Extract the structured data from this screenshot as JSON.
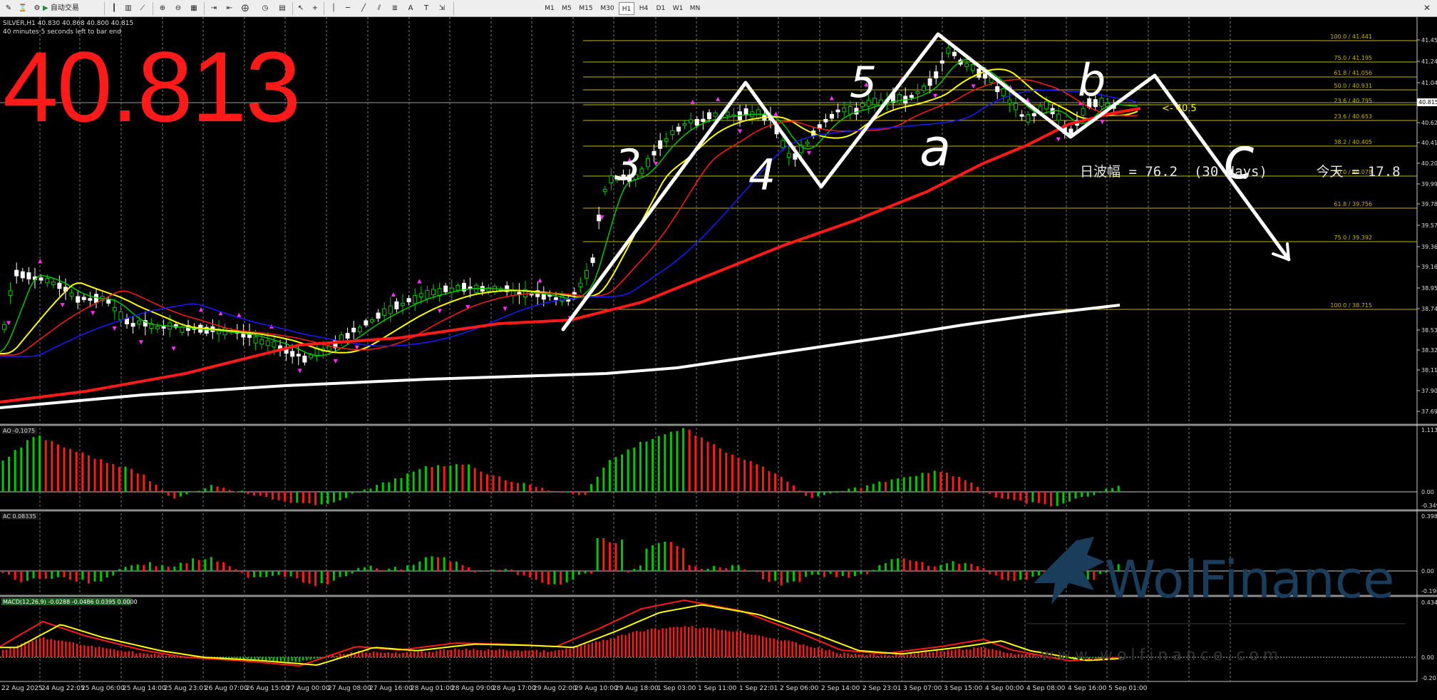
{
  "toolbar": {
    "auto_trading_label": "自动交易",
    "timeframes": [
      "M1",
      "M5",
      "M15",
      "M30",
      "H1",
      "H4",
      "D1",
      "W1",
      "MN"
    ],
    "active_timeframe": "H1"
  },
  "chart": {
    "symbol_line": "SILVER,H1  40.830 40.868 40.800 40.815",
    "timer_line": "40 minutes 5 seconds left to bar end",
    "big_price": "40.813",
    "current_price_label": "40.815",
    "arrow_label": "<- 40.5",
    "range_text": "日波幅 = 76.2  (30 days)      今天 = 17.8",
    "wave_labels": [
      "3",
      "4",
      "5",
      "a",
      "b",
      "c"
    ],
    "watermark": "WolFinance",
    "watermark_url": "www.wolfinance.com"
  },
  "price_axis": [
    "41.455",
    "41.245",
    "41.040",
    "40.620",
    "40.415",
    "40.205",
    "39.995",
    "39.785",
    "39.575",
    "39.365",
    "39.160",
    "38.950",
    "38.740",
    "38.530",
    "38.320",
    "38.115",
    "37.905",
    "37.695"
  ],
  "fib_levels": [
    {
      "label": "100.0 / 41.441"
    },
    {
      "label": "75.0 / 41.195"
    },
    {
      "label": "61.8 / 41.056"
    },
    {
      "label": "50.0 / 40.931"
    },
    {
      "label": "23.6 / 40.795"
    },
    {
      "label": "23.6 / 40.653"
    },
    {
      "label": "38.2 / 40.405"
    },
    {
      "label": "50.0 / 40.078"
    },
    {
      "label": "61.8 / 39.756"
    },
    {
      "label": "75.0 / 39.392"
    },
    {
      "label": "100.0 / 38.715"
    }
  ],
  "time_axis": [
    "22 Aug 2025",
    "24 Aug 22:05",
    "25 Aug 06:00",
    "25 Aug 14:00",
    "25 Aug 23:01",
    "26 Aug 07:00",
    "26 Aug 15:00",
    "27 Aug 00:00",
    "27 Aug 08:00",
    "27 Aug 16:00",
    "28 Aug 01:00",
    "28 Aug 09:00",
    "28 Aug 17:00",
    "29 Aug 02:00",
    "29 Aug 10:00",
    "29 Aug 18:00",
    "1 Sep 03:00",
    "1 Sep 11:00",
    "1 Sep 22:01",
    "2 Sep 06:00",
    "2 Sep 14:00",
    "2 Sep 23:01",
    "3 Sep 07:00",
    "3 Sep 15:00",
    "4 Sep 00:00",
    "4 Sep 08:00",
    "4 Sep 16:00",
    "5 Sep 01:00"
  ],
  "ao": {
    "label": "AO -0.1075",
    "top": "1.1133",
    "zero": "0.00",
    "bottom": "-0.3497"
  },
  "ac": {
    "label": "AC 0.08335",
    "top": "0.3982",
    "zero": "0.00",
    "bottom": "-0.1980"
  },
  "macd": {
    "label": "MACD(12,26,9) -0.0288 -0.0486 0.0395 0.0000",
    "top": "0.4345",
    "zero": "0.00",
    "bottom": "-0.2015"
  },
  "colors": {
    "up": "#00c800",
    "down": "#ff1a1a",
    "ma_yellow": "#ffff00",
    "ma_blue": "#1a1aff",
    "ma_red": "#ff1a1a",
    "ma_white": "#ffffff",
    "fib": "#c8b400",
    "panel_bg": "#000000"
  }
}
